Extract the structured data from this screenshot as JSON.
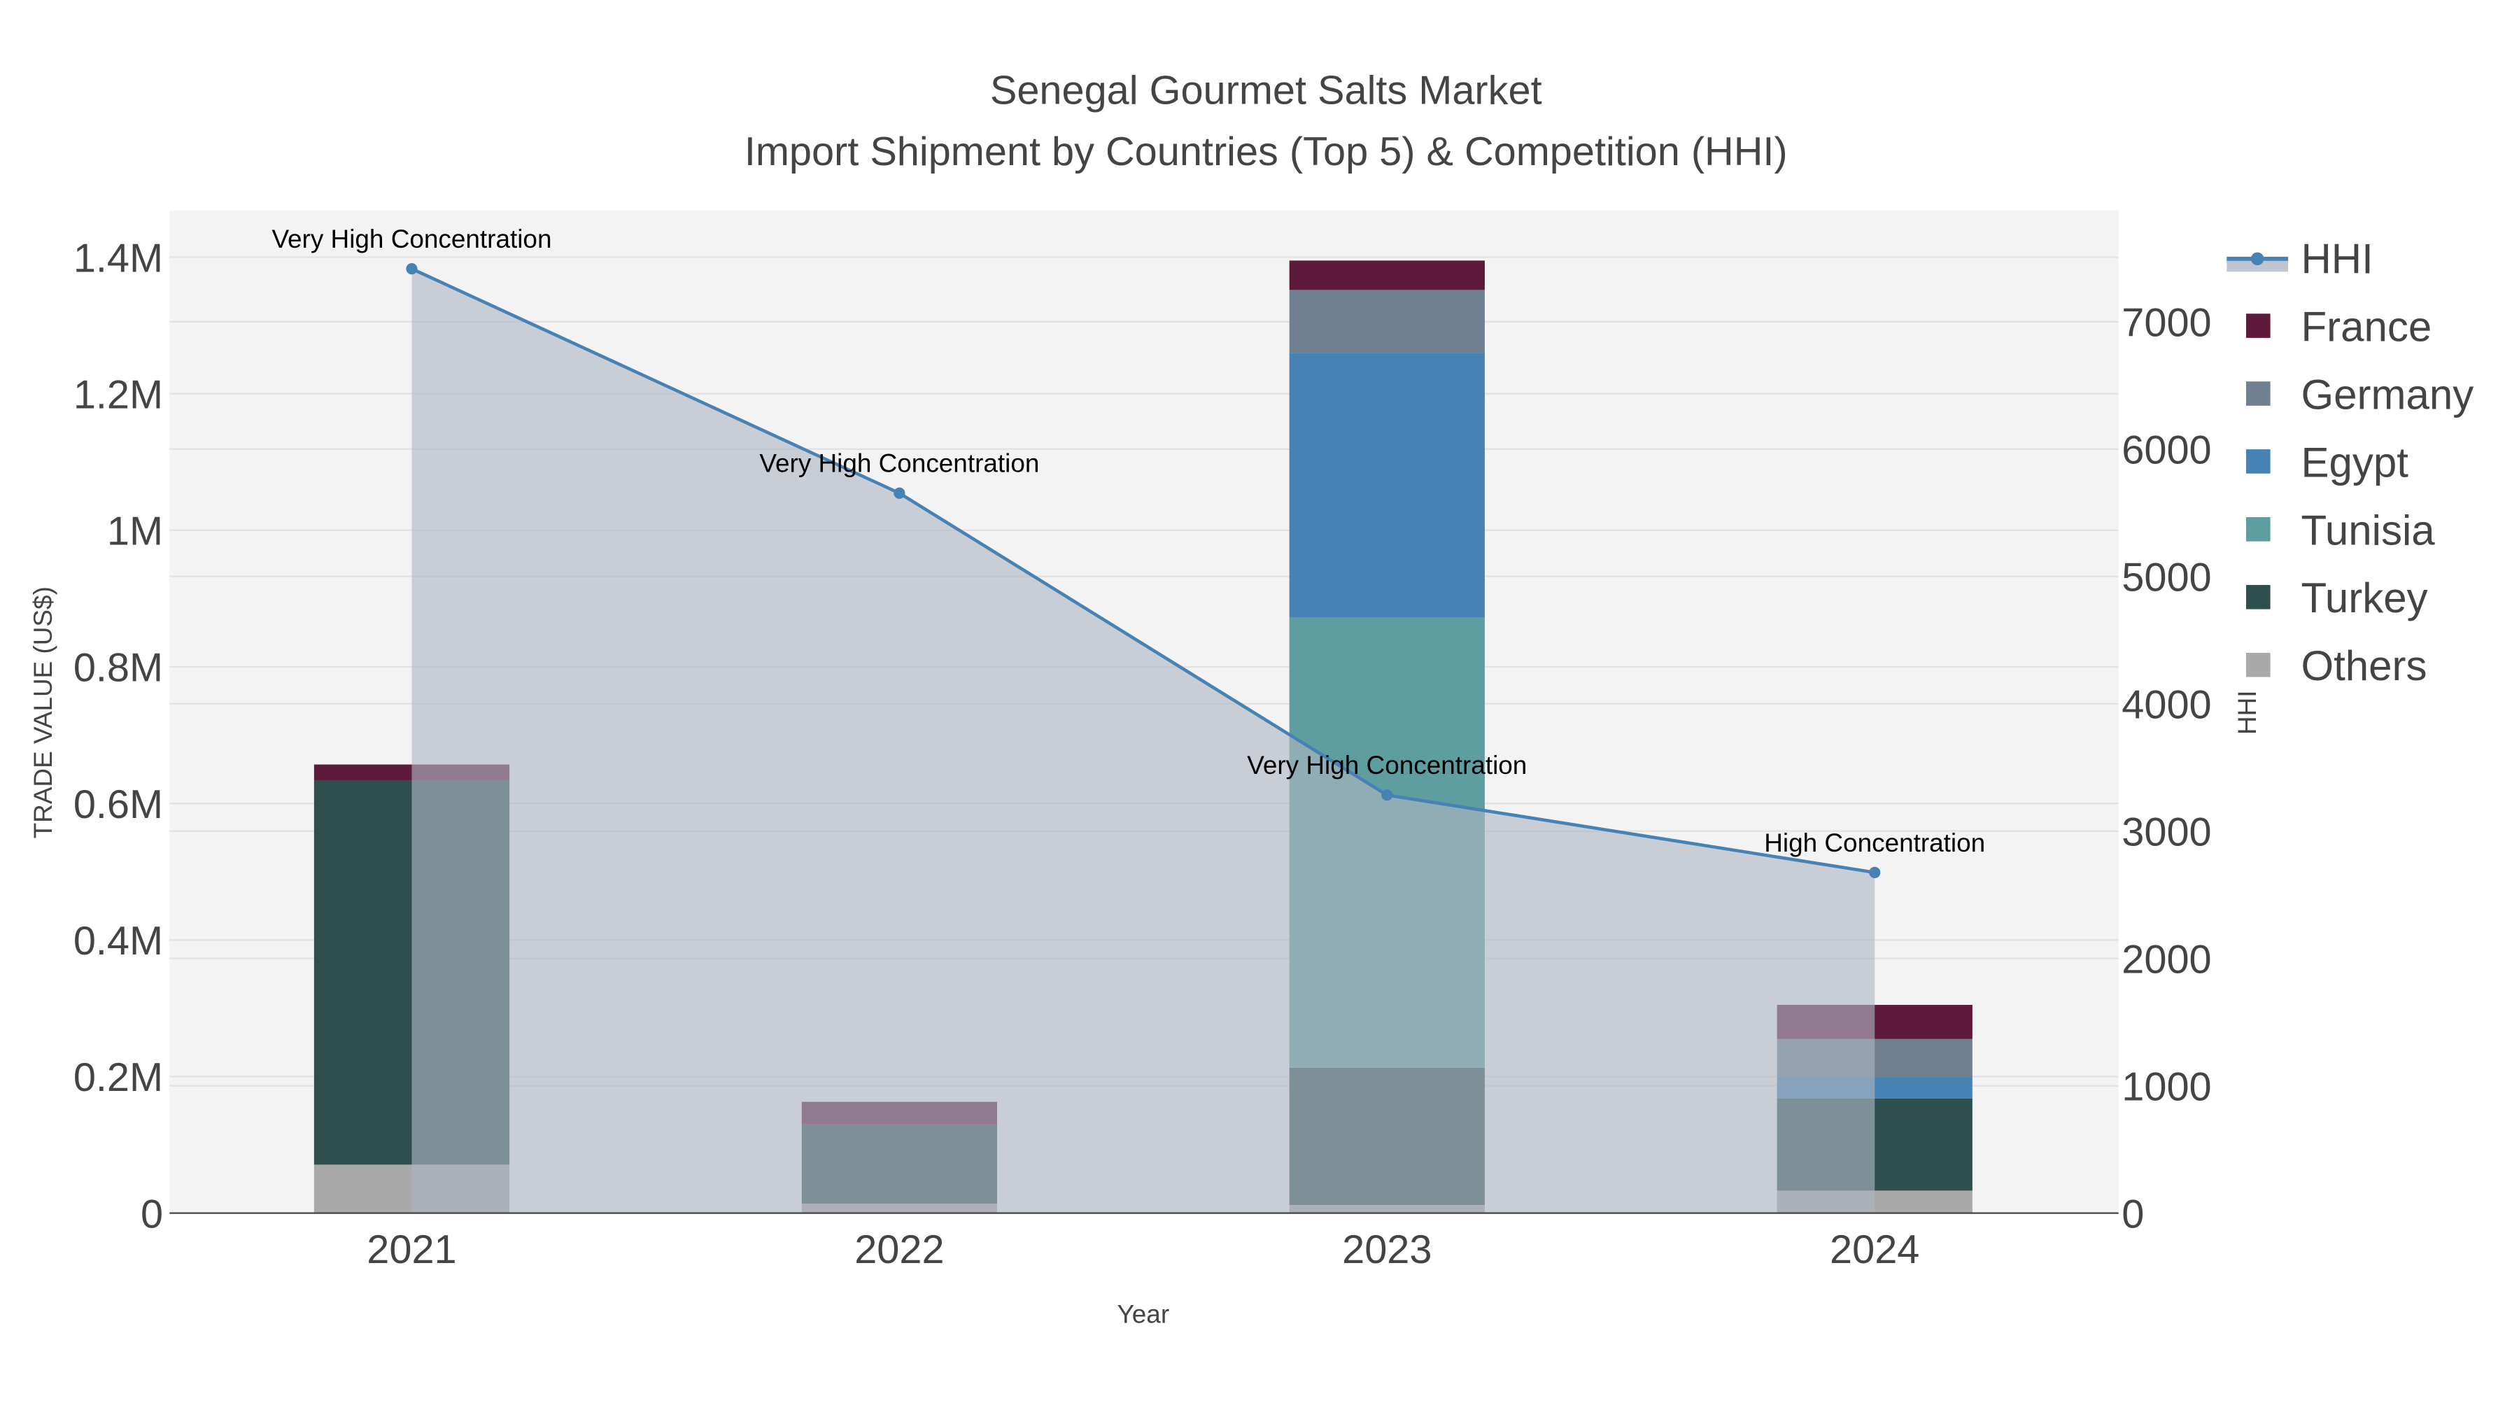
{
  "chart_data": {
    "type": "bar",
    "title": "Senegal Gourmet Salts Market",
    "subtitle": "Import Shipment by Countries (Top 5) & Competition (HHI)",
    "xlabel": "Year",
    "ylabel": "TRADE VALUE (US$)",
    "y2label": "HHI",
    "categories": [
      "2021",
      "2022",
      "2023",
      "2024"
    ],
    "ylim": [
      0,
      1460000
    ],
    "y2lim": [
      0,
      7800
    ],
    "yticks": [
      0,
      200000,
      400000,
      600000,
      800000,
      1000000,
      1200000,
      1400000
    ],
    "ytick_labels": [
      "0",
      "0.2M",
      "0.4M",
      "0.6M",
      "0.8M",
      "1M",
      "1.2M",
      "1.4M"
    ],
    "y2ticks": [
      0,
      1000,
      2000,
      3000,
      4000,
      5000,
      6000,
      7000
    ],
    "y2tick_labels": [
      "0",
      "1000",
      "2000",
      "3000",
      "4000",
      "5000",
      "6000",
      "7000"
    ],
    "stacked": true,
    "series": [
      {
        "name": "Others",
        "color": "#a9a9a9",
        "values": [
          71000,
          14000,
          12000,
          33000
        ]
      },
      {
        "name": "Turkey",
        "color": "#2f4f4f",
        "values": [
          563000,
          116000,
          201000,
          135000
        ]
      },
      {
        "name": "Tunisia",
        "color": "#5f9ea0",
        "values": [
          0,
          0,
          659000,
          0
        ]
      },
      {
        "name": "Egypt",
        "color": "#4682b4",
        "values": [
          0,
          0,
          388000,
          31000
        ]
      },
      {
        "name": "Germany",
        "color": "#708090",
        "values": [
          0,
          0,
          92000,
          56000
        ]
      },
      {
        "name": "France",
        "color": "#5e1a3a",
        "values": [
          23000,
          33000,
          43000,
          50000
        ]
      }
    ],
    "line": {
      "name": "HHI",
      "color": "#4682b4",
      "values": [
        7416,
        5654,
        3283,
        2675
      ],
      "axis": "right",
      "fill": true
    },
    "annotations": [
      "Very High Concentration",
      "Very High Concentration",
      "Very High Concentration",
      "High Concentration"
    ],
    "legend_order": [
      "HHI",
      "France",
      "Germany",
      "Egypt",
      "Tunisia",
      "Turkey",
      "Others"
    ],
    "legend_position": "right",
    "grid": true
  }
}
